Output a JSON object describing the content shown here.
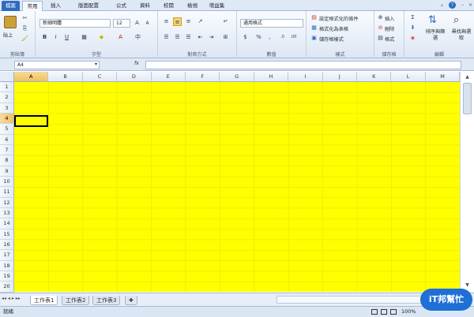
{
  "tabs": [
    {
      "label": "檔案",
      "kind": "file"
    },
    {
      "label": "常用",
      "kind": "active"
    },
    {
      "label": "插入",
      "kind": ""
    },
    {
      "label": "版面配置",
      "kind": ""
    },
    {
      "label": "公式",
      "kind": ""
    },
    {
      "label": "資料",
      "kind": ""
    },
    {
      "label": "校閱",
      "kind": ""
    },
    {
      "label": "檢視",
      "kind": ""
    },
    {
      "label": "增益集",
      "kind": ""
    }
  ],
  "clipboard": {
    "paste": "貼上",
    "label": "剪貼簿"
  },
  "font": {
    "name": "新細明體",
    "size": "12",
    "bold": "B",
    "italic": "I",
    "underline": "U",
    "label": "字型"
  },
  "alignment": {
    "label": "對齊方式"
  },
  "number": {
    "format": "通用格式",
    "currency": "$",
    "percent": "%",
    "comma": ",",
    "label": "數值"
  },
  "styles": {
    "conditional": "設定格式化的條件",
    "table": "格式化為表格",
    "cell": "儲存格樣式",
    "label": "樣式"
  },
  "cells_group": {
    "insert": "插入",
    "delete": "刪除",
    "format": "格式",
    "label": "儲存格"
  },
  "editing": {
    "sum": "Σ",
    "sort": "排序與篩選",
    "find": "尋找與選取",
    "label": "編輯"
  },
  "formula_bar": {
    "name_box": "A4",
    "fx": "fx",
    "value": ""
  },
  "columns": [
    "A",
    "B",
    "C",
    "D",
    "E",
    "F",
    "G",
    "H",
    "I",
    "J",
    "K",
    "L",
    "M"
  ],
  "rows": [
    "1",
    "2",
    "3",
    "4",
    "5",
    "6",
    "7",
    "8",
    "9",
    "10",
    "11",
    "12",
    "13",
    "14",
    "15",
    "16",
    "17",
    "18",
    "19",
    "20",
    "21"
  ],
  "selected_cell": {
    "column": "A",
    "row": "4"
  },
  "fill_color": "#ffff00",
  "sheets": [
    {
      "label": "工作表1",
      "active": true
    },
    {
      "label": "工作表2",
      "active": false
    },
    {
      "label": "工作表3",
      "active": false
    }
  ],
  "status": {
    "mode": "就緒",
    "zoom": "100%"
  },
  "watermark": "iT邦幫忙"
}
